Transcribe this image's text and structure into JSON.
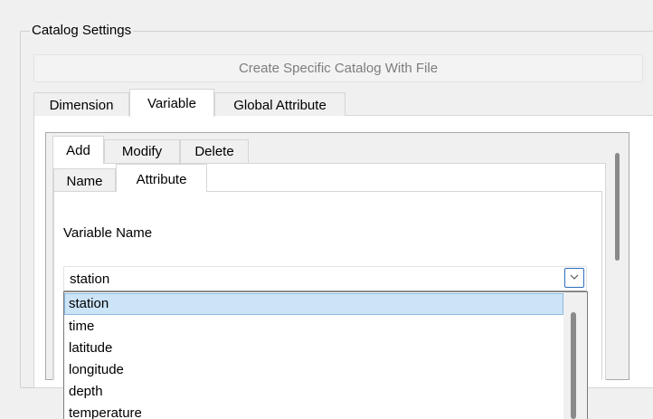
{
  "catalog_settings": {
    "title": "Catalog Settings",
    "create_button_label": "Create Specific Catalog With File"
  },
  "main_tabs": [
    {
      "label": "Dimension",
      "selected": false
    },
    {
      "label": "Variable",
      "selected": true
    },
    {
      "label": "Global Attribute",
      "selected": false
    }
  ],
  "action_tabs": [
    {
      "label": "Add",
      "selected": true
    },
    {
      "label": "Modify",
      "selected": false
    },
    {
      "label": "Delete",
      "selected": false
    }
  ],
  "sub_tabs": [
    {
      "label": "Name",
      "selected": false
    },
    {
      "label": "Attribute",
      "selected": true
    }
  ],
  "variable_name": {
    "label": "Variable Name",
    "selected_value": "station",
    "options": [
      "station",
      "time",
      "latitude",
      "longitude",
      "depth",
      "temperature"
    ]
  },
  "colors": {
    "selection_bg": "#cce4f7",
    "selection_border": "#8cbbe3",
    "combo_button_border": "#2f6fbf"
  }
}
